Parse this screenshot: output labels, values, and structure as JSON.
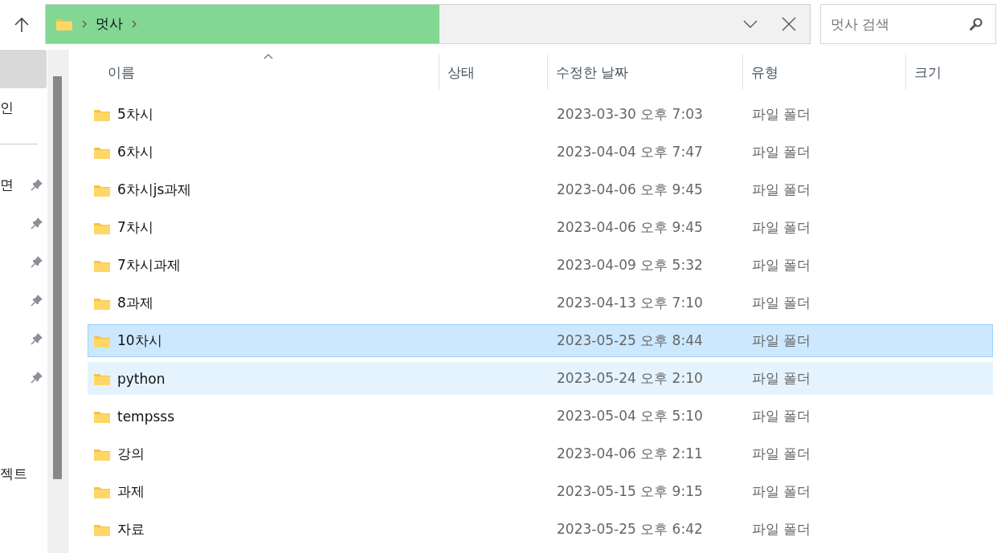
{
  "address_bar": {
    "path": [
      {
        "label": "멋사"
      }
    ],
    "level": 0.515
  },
  "search": {
    "placeholder": "멋사 검색"
  },
  "sidebar": {
    "items": [
      {
        "kind": "blank",
        "selected": true
      },
      {
        "kind": "text",
        "label": "인",
        "selected": false
      },
      {
        "kind": "divider"
      },
      {
        "kind": "pinned",
        "label": "면",
        "selected": false
      },
      {
        "kind": "pinned",
        "selected": false
      },
      {
        "kind": "pinned",
        "selected": false
      },
      {
        "kind": "pinned",
        "selected": false
      },
      {
        "kind": "pinned",
        "selected": false
      },
      {
        "kind": "pinned",
        "selected": false
      },
      {
        "kind": "text",
        "label": "젝트",
        "selected": false
      }
    ]
  },
  "table": {
    "columns": [
      {
        "label": "이름",
        "sorted": true
      },
      {
        "label": "상태",
        "sorted": false
      },
      {
        "label": "수정한 날짜",
        "sorted": false
      },
      {
        "label": "유형",
        "sorted": false
      },
      {
        "label": "크기",
        "sorted": false
      }
    ],
    "rows": [
      {
        "name": "5차시",
        "modified": "2023-03-30 오후 7:03",
        "type": "파일 폴더",
        "selected": false,
        "hovered": false
      },
      {
        "name": "6차시",
        "modified": "2023-04-04 오후 7:47",
        "type": "파일 폴더",
        "selected": false,
        "hovered": false
      },
      {
        "name": "6차시js과제",
        "modified": "2023-04-06 오후 9:45",
        "type": "파일 폴더",
        "selected": false,
        "hovered": false
      },
      {
        "name": "7차시",
        "modified": "2023-04-06 오후 9:45",
        "type": "파일 폴더",
        "selected": false,
        "hovered": false
      },
      {
        "name": "7차시과제",
        "modified": "2023-04-09 오후 5:32",
        "type": "파일 폴더",
        "selected": false,
        "hovered": false
      },
      {
        "name": "8과제",
        "modified": "2023-04-13 오후 7:10",
        "type": "파일 폴더",
        "selected": false,
        "hovered": false
      },
      {
        "name": "10차시",
        "modified": "2023-05-25 오후 8:44",
        "type": "파일 폴더",
        "selected": true,
        "hovered": false
      },
      {
        "name": "python",
        "modified": "2023-05-24 오후 2:10",
        "type": "파일 폴더",
        "selected": false,
        "hovered": true
      },
      {
        "name": "tempsss",
        "modified": "2023-05-04 오후 5:10",
        "type": "파일 폴더",
        "selected": false,
        "hovered": false
      },
      {
        "name": "강의",
        "modified": "2023-04-06 오후 2:11",
        "type": "파일 폴더",
        "selected": false,
        "hovered": false
      },
      {
        "name": "과제",
        "modified": "2023-05-15 오후 9:15",
        "type": "파일 폴더",
        "selected": false,
        "hovered": false
      },
      {
        "name": "자료",
        "modified": "2023-05-25 오후 6:42",
        "type": "파일 폴더",
        "selected": false,
        "hovered": false
      }
    ]
  }
}
